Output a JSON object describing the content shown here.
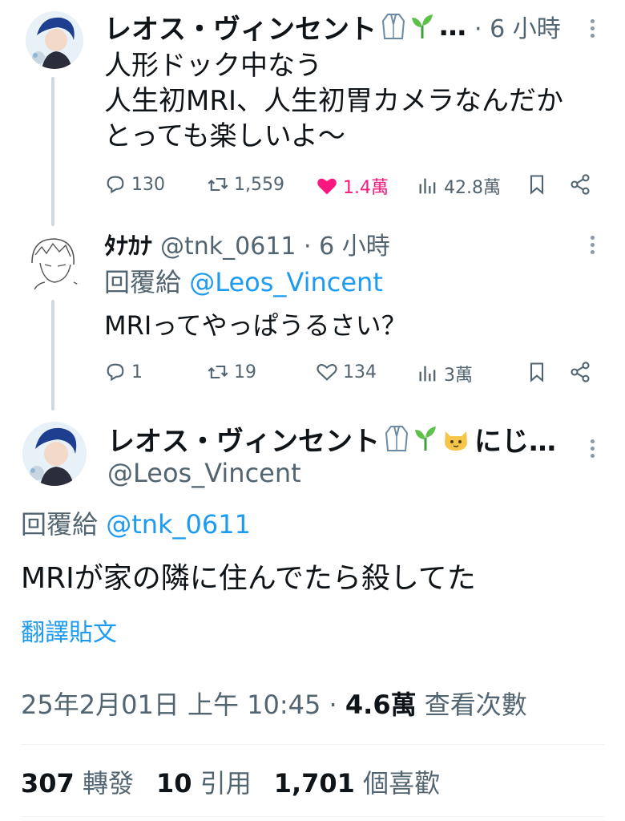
{
  "tweet1": {
    "display_name": "レオス・ヴィンセント",
    "name_suffix": "…",
    "time": "· 6 小時",
    "lines": [
      "人形ドック中なう",
      "人生初MRI、人生初胃カメラなんだか",
      "とっても楽しいよ〜"
    ],
    "replies": "130",
    "retweets": "1,559",
    "likes": "1.4萬",
    "views": "42.8萬",
    "like_color": "#f91880"
  },
  "tweet2": {
    "display_name": "ﾀﾅｶﾅ",
    "handle_time": "@tnk_0611 · 6 小時",
    "reply_prefix": "回覆給",
    "reply_to": "@Leos_Vincent",
    "text": "MRIってやっぱうるさい？",
    "replies": "1",
    "retweets": "19",
    "likes": "134",
    "views": "3萬"
  },
  "main": {
    "display_name": "レオス・ヴィンセント",
    "name_suffix": "にじ…",
    "handle": "@Leos_Vincent",
    "reply_prefix": "回覆給",
    "reply_to": "@tnk_0611",
    "text": "MRIが家の隣に住んでたら殺してた",
    "translate": "翻譯貼文",
    "timestamp": "25年2月01日 上午 10:45",
    "separator": "·",
    "views_count": "4.6萬",
    "views_label": "查看次數",
    "retweet_count": "307",
    "retweet_label": "轉發",
    "quote_count": "10",
    "quote_label": "引用",
    "like_count": "1,701",
    "like_label": "個喜歡"
  },
  "colors": {
    "link": "#1d9bf0",
    "muted": "#536471",
    "thread_line": "#cfd9de"
  }
}
